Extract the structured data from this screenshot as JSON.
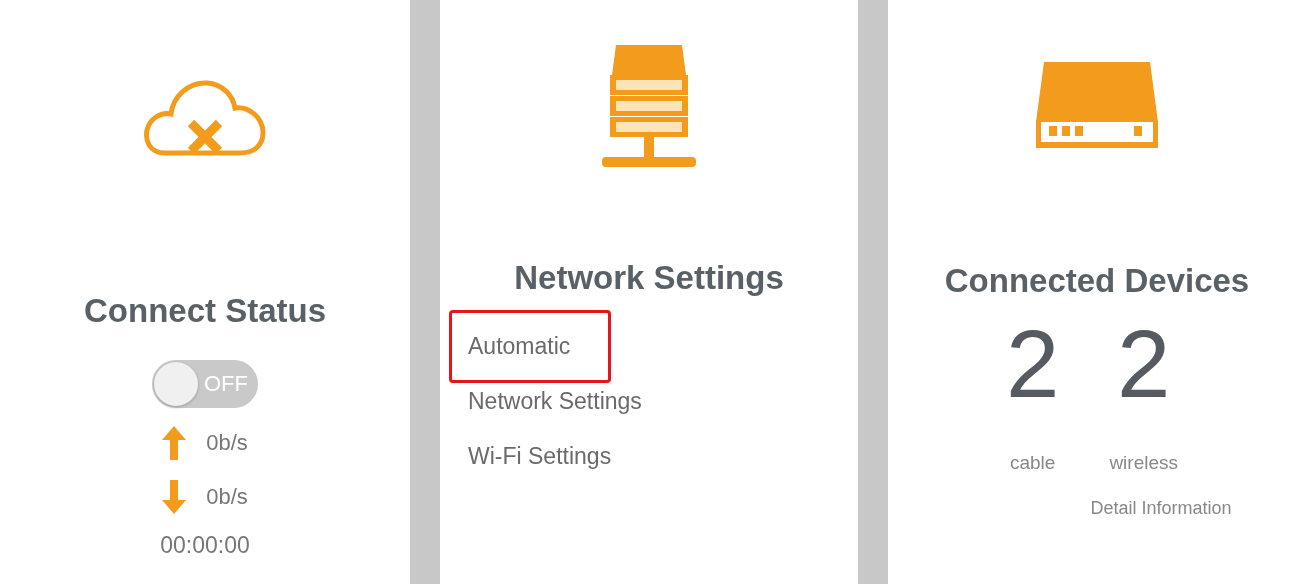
{
  "connect_status": {
    "title": "Connect Status",
    "toggle": {
      "label": "OFF",
      "on": false
    },
    "upload": "0b/s",
    "download": "0b/s",
    "duration": "00:00:00"
  },
  "network_settings": {
    "title": "Network Settings",
    "items": [
      {
        "label": "Automatic",
        "highlighted": true
      },
      {
        "label": "Network Settings",
        "highlighted": false
      },
      {
        "label": "Wi-Fi Settings",
        "highlighted": false
      }
    ]
  },
  "connected_devices": {
    "title": "Connected Devices",
    "counts": [
      {
        "value": "2",
        "label": "cable"
      },
      {
        "value": "2",
        "label": "wireless"
      }
    ],
    "detail_link": "Detail Information"
  }
}
